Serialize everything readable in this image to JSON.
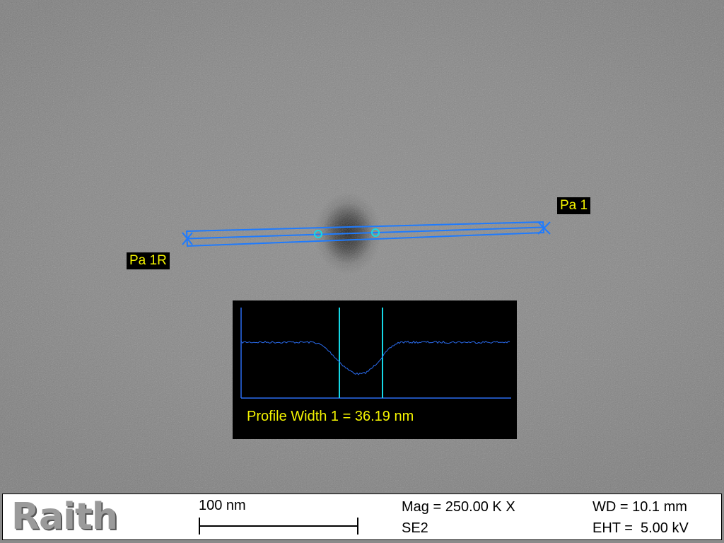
{
  "measurement": {
    "label_start": "Pa 1R",
    "label_end": "Pa 1",
    "line_color": "#1e7bff",
    "cursor_color": "#15d8e6"
  },
  "profile": {
    "readout": "Profile Width 1 = 36.19 nm",
    "trace_color": "#2a6cf0",
    "cursor_color": "#15d8e6",
    "text_color": "#f4f400"
  },
  "info_bar": {
    "logo": "Raith",
    "scale_bar_label": "100 nm",
    "magnification": "Mag = 250.00 K X",
    "detector": "SE2",
    "working_distance": "WD = 10.1 mm",
    "beam_voltage": "EHT =  5.00 kV"
  }
}
